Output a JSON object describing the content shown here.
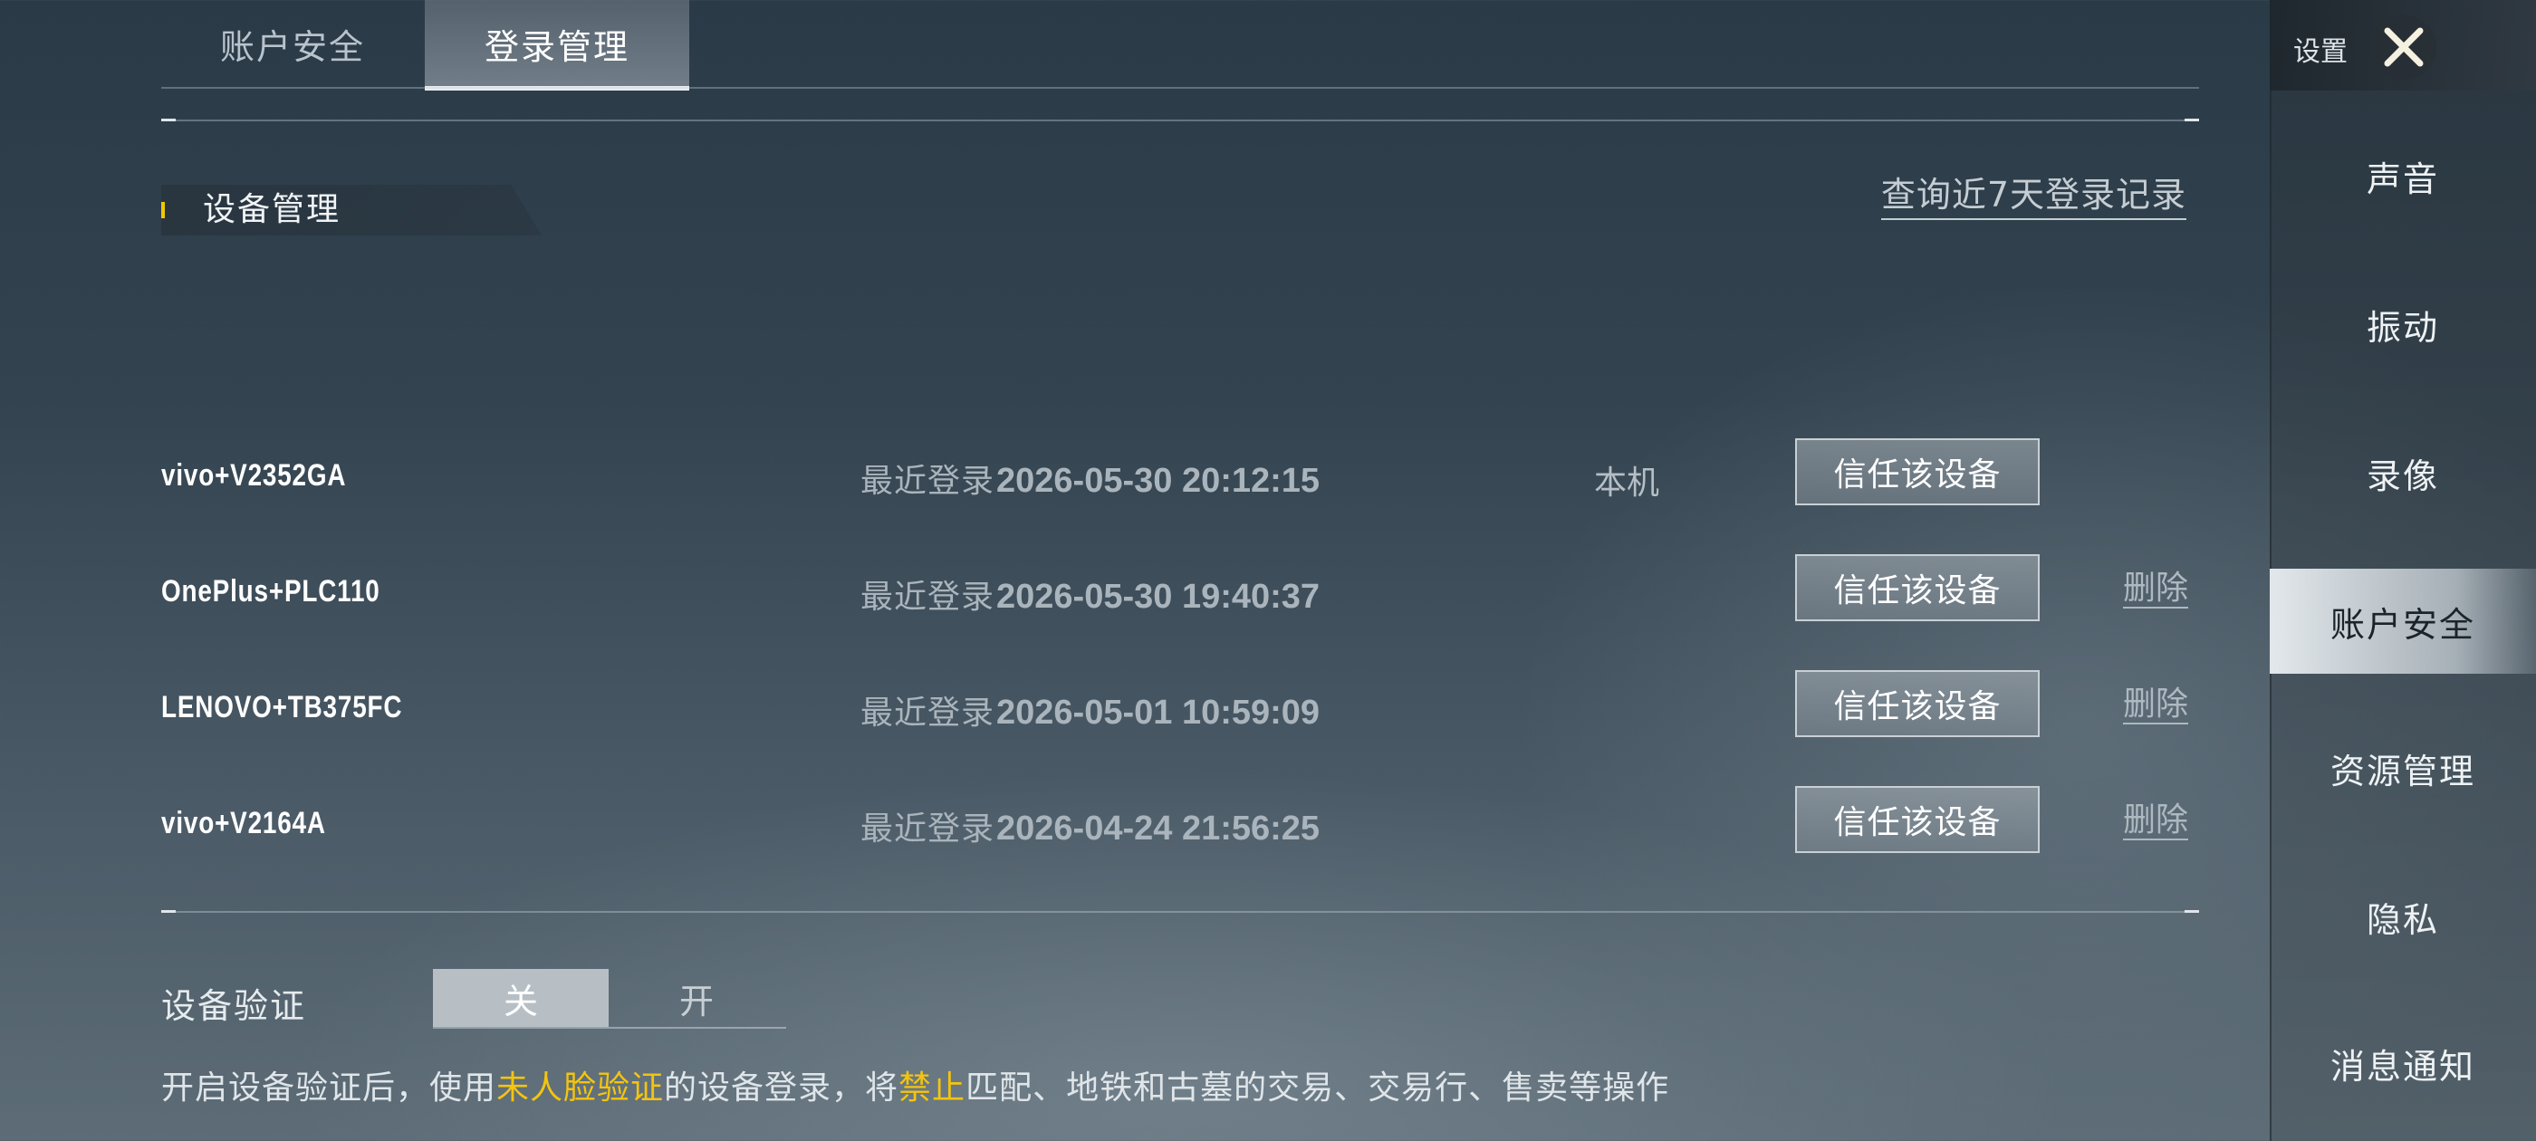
{
  "tabs": [
    {
      "label": "账户安全",
      "active": false
    },
    {
      "label": "登录管理",
      "active": true
    }
  ],
  "section": {
    "title": "设备管理",
    "query_link": "查询近7天登录记录"
  },
  "devices": [
    {
      "name": "vivo+V2352GA",
      "login_label": "最近登录",
      "login_time": "2026-05-30 20:12:15",
      "tag": "本机",
      "trust_label": "信任该设备",
      "delete_label": ""
    },
    {
      "name": "OnePlus+PLC110",
      "login_label": "最近登录",
      "login_time": "2026-05-30 19:40:37",
      "tag": "",
      "trust_label": "信任该设备",
      "delete_label": "删除"
    },
    {
      "name": "LENOVO+TB375FC",
      "login_label": "最近登录",
      "login_time": "2026-05-01 10:59:09",
      "tag": "",
      "trust_label": "信任该设备",
      "delete_label": "删除"
    },
    {
      "name": "vivo+V2164A",
      "login_label": "最近登录",
      "login_time": "2026-04-24 21:56:25",
      "tag": "",
      "trust_label": "信任该设备",
      "delete_label": "删除"
    }
  ],
  "verification": {
    "label": "设备验证",
    "off_label": "关",
    "on_label": "开",
    "selected": "关",
    "note_part1": "开启设备验证后，使用",
    "note_hl1": "未人脸验证",
    "note_part2": "的设备登录，将",
    "note_hl2": "禁止",
    "note_part3": "匹配、地铁和古墓的交易、交易行、售卖等操作"
  },
  "sidebar": {
    "title": "设置",
    "items": [
      {
        "label": "声音",
        "active": false
      },
      {
        "label": "振动",
        "active": false
      },
      {
        "label": "录像",
        "active": false
      },
      {
        "label": "账户安全",
        "active": true
      },
      {
        "label": "资源管理",
        "active": false
      },
      {
        "label": "隐私",
        "active": false
      },
      {
        "label": "消息通知",
        "active": false
      }
    ]
  },
  "colors": {
    "highlight": "#f3c410",
    "accent_bar": "#f0c800"
  }
}
